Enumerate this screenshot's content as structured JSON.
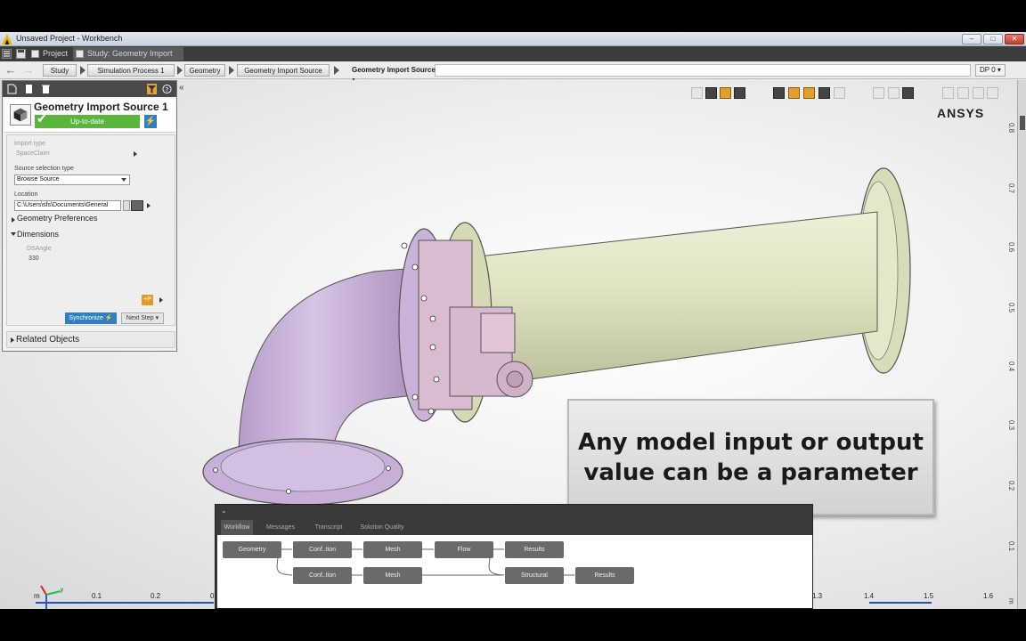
{
  "window": {
    "title": "Unsaved Project - Workbench",
    "controls": [
      "–",
      "□",
      "✕"
    ]
  },
  "tabs": [
    {
      "label": "Project",
      "active": false
    },
    {
      "label": "Study: Geometry Import S...",
      "active": true
    }
  ],
  "breadcrumb": {
    "items": [
      "Study",
      "Simulation Process 1",
      "Geometry",
      "Geometry Import Source"
    ],
    "current": "Geometry Import Source 1",
    "dp_selector": "DP 0 ▾"
  },
  "properties": {
    "title": "Geometry Import Source 1",
    "status": "Up-to-date",
    "import_type_label": "Import type",
    "import_type_value": "SpaceClaim",
    "source_selection_label": "Source selection type",
    "source_selection_value": "Browse Source",
    "location_label": "Location",
    "location_value": "C:\\Users\\sfs\\Documents\\General",
    "geometry_preferences": "Geometry Preferences",
    "dimensions": "Dimensions",
    "dim_name": "DSAngle",
    "dim_value": "330",
    "synchronize_label": "Synchronize",
    "next_step_label": "Next Step ▾",
    "related_objects": "Related Objects",
    "param_icon_label": "+P"
  },
  "viewport": {
    "brand": "ANSYS",
    "callout": [
      "Any model input or output",
      "value can be a parameter"
    ],
    "right_ruler_ticks": [
      "0.8",
      "0.7",
      "0.6",
      "0.5",
      "0.4",
      "0.3",
      "0.2",
      "0.1",
      "m"
    ],
    "bottom_axis_ticks": [
      "m",
      "0.1",
      "0.2",
      "0",
      "1.3",
      "1.4",
      "1.5",
      "1.6"
    ],
    "triad_labels": {
      "y": "y",
      "z": "z"
    },
    "accent_color": "#2f7fc1",
    "pipe_elbow_color": "#c9b3d9",
    "pipe_straight_color": "#dfe3c1"
  },
  "workflow": {
    "collapse": "⌄",
    "tabs": [
      {
        "label": "Workflow",
        "active": true
      },
      {
        "label": "Messages",
        "active": false
      },
      {
        "label": "Transcript",
        "active": false
      },
      {
        "label": "Solution Quality",
        "active": false
      }
    ],
    "row1": [
      "Geometry",
      "Conf..tion",
      "Mesh",
      "Flow",
      "Results"
    ],
    "row2": [
      "Conf..tion",
      "Mesh",
      "Structural",
      "Results"
    ]
  }
}
